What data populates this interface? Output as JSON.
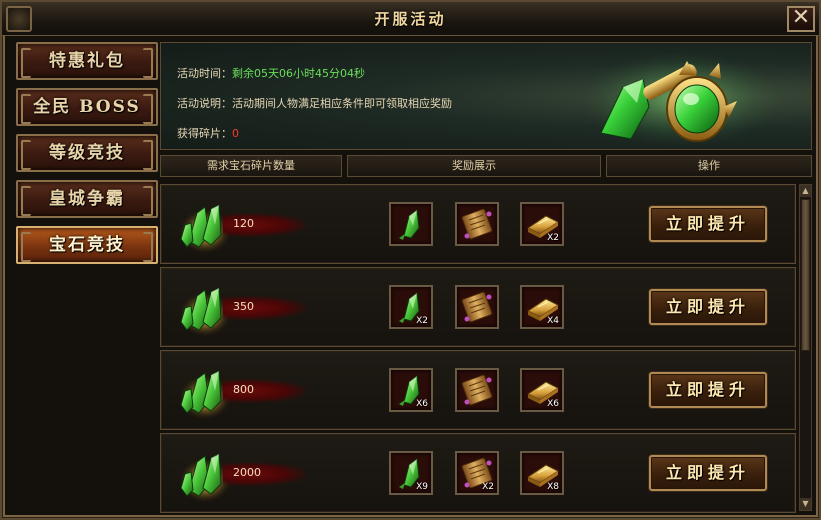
{
  "window": {
    "title": "开服活动",
    "close_label": "✕"
  },
  "sidebar": {
    "items": [
      {
        "label": "特惠礼包",
        "active": false
      },
      {
        "label": "全民 BOSS",
        "active": false
      },
      {
        "label": "等级竞技",
        "active": false
      },
      {
        "label": "皇城争霸",
        "active": false
      },
      {
        "label": "宝石竞技",
        "active": true
      }
    ]
  },
  "info": {
    "time_label": "活动时间：",
    "time_value": "剩余05天06小时45分04秒",
    "desc_label": "活动说明：",
    "desc_value": "活动期间人物满足相应条件即可领取相应奖励",
    "shards_label": "获得碎片：",
    "shards_value": "0"
  },
  "table": {
    "headers": [
      "需求宝石碎片数量",
      "奖励展示",
      "操作"
    ],
    "button_label": "立即提升",
    "rows": [
      {
        "required": "120",
        "rewards": [
          {
            "icon": "green-crystal-icon",
            "count": ""
          },
          {
            "icon": "scroll-icon",
            "count": ""
          },
          {
            "icon": "gold-ingot-icon",
            "count": "X2"
          }
        ]
      },
      {
        "required": "350",
        "rewards": [
          {
            "icon": "green-crystal-icon",
            "count": "X2"
          },
          {
            "icon": "scroll-icon",
            "count": ""
          },
          {
            "icon": "gold-ingot-icon",
            "count": "X4"
          }
        ]
      },
      {
        "required": "800",
        "rewards": [
          {
            "icon": "green-crystal-icon",
            "count": "X6"
          },
          {
            "icon": "scroll-icon",
            "count": ""
          },
          {
            "icon": "gold-ingot-icon",
            "count": "X6"
          }
        ]
      },
      {
        "required": "2000",
        "rewards": [
          {
            "icon": "green-crystal-icon",
            "count": "X9"
          },
          {
            "icon": "scroll-icon",
            "count": "X2"
          },
          {
            "icon": "gold-ingot-icon",
            "count": "X8"
          }
        ]
      }
    ]
  },
  "colors": {
    "accent_green": "#6adf5a",
    "alert_red": "#ff3a2a",
    "gold": "#d8a63a"
  },
  "scrollbar": {
    "up_glyph": "▲",
    "down_glyph": "▼"
  }
}
